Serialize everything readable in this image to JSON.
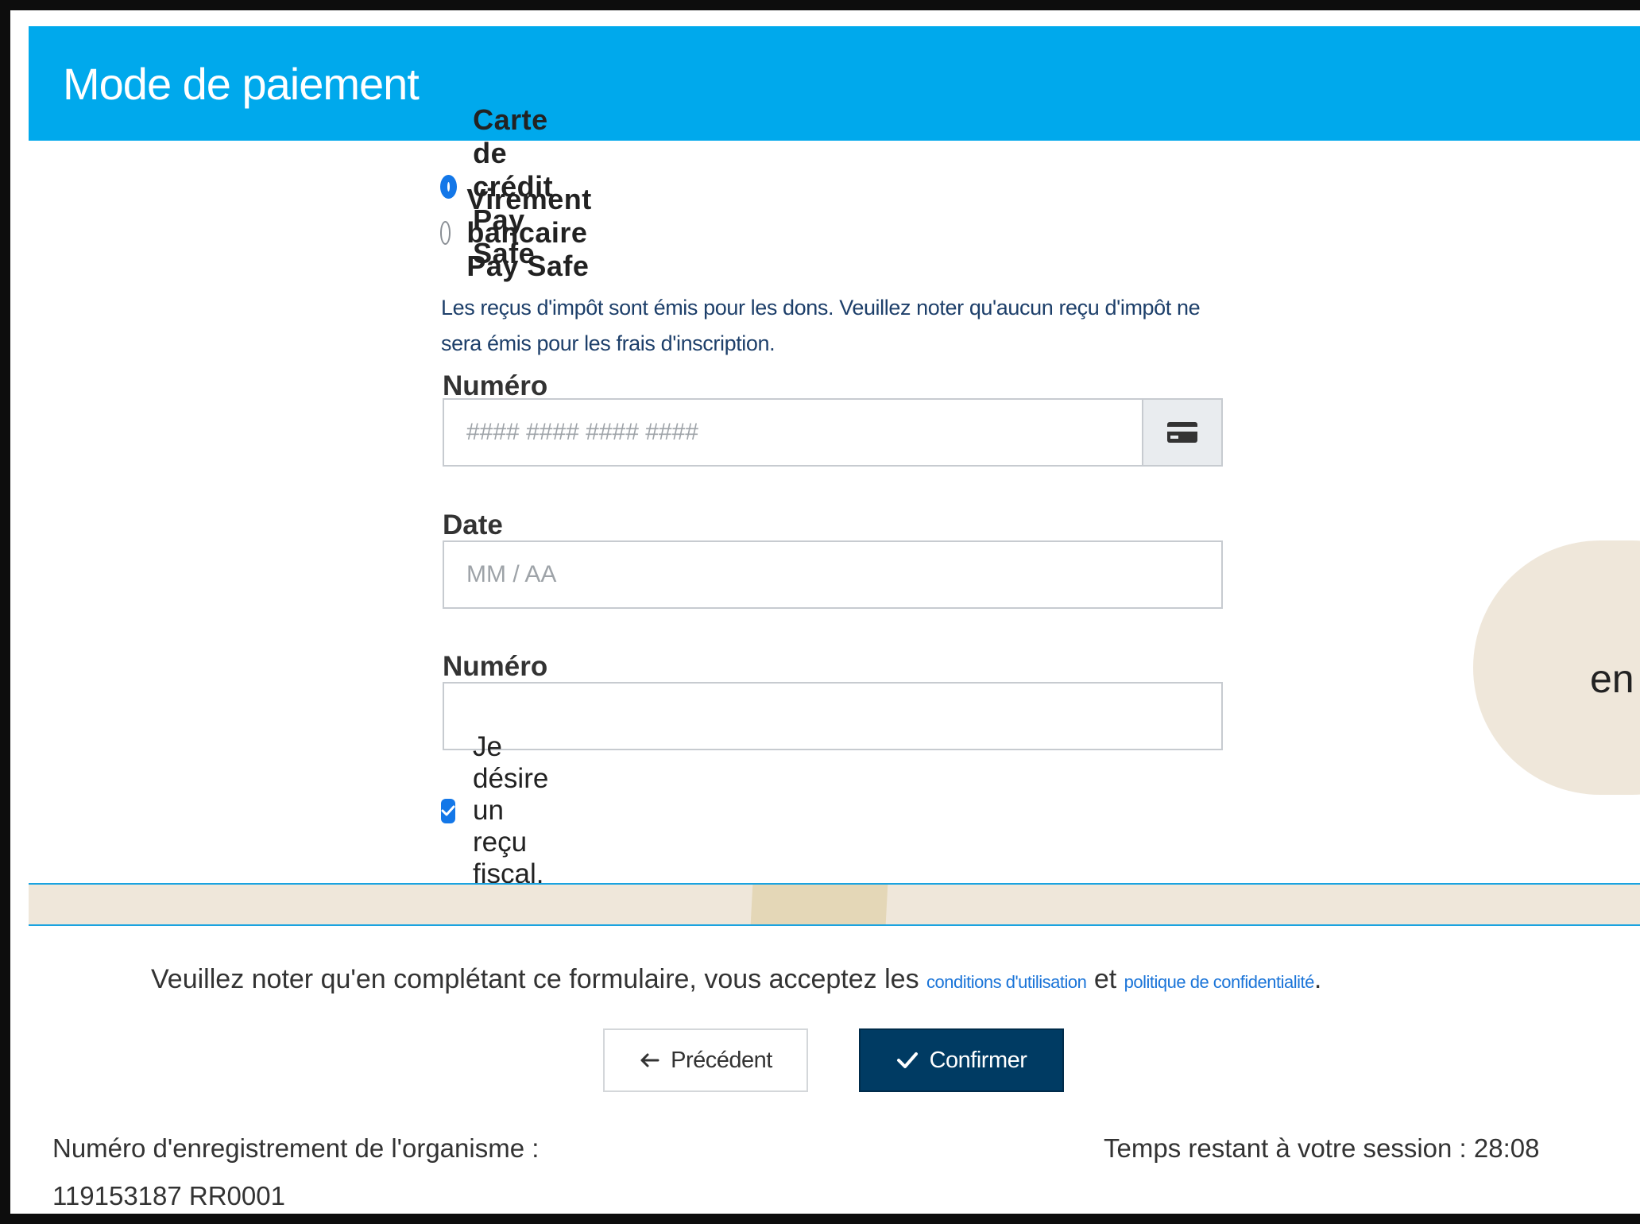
{
  "header": {
    "title": "Mode de paiement"
  },
  "payment_options": [
    {
      "label": "Carte de crédit Pay Safe",
      "selected": true
    },
    {
      "label": "Virement bancaire Pay Safe",
      "selected": false
    }
  ],
  "tax_note": "Les reçus d'impôt sont émis pour les dons. Veuillez noter qu'aucun reçu d'impôt ne sera émis pour les frais d'inscription.",
  "card_number": {
    "label": "Numéro de carte",
    "placeholder": "#### #### #### ####",
    "icon": "credit-card-icon"
  },
  "expiry": {
    "label": "Date d'expiration",
    "placeholder": "MM / AA"
  },
  "cvv": {
    "label": "Numéro de contrôle",
    "placeholder": ""
  },
  "tax_receipt": {
    "label": "Je désire un reçu fiscal.",
    "checked": true
  },
  "side_bubble": {
    "text": "en"
  },
  "terms": {
    "prefix": "Veuillez noter qu'en complétant ce formulaire, vous acceptez les",
    "terms_link": "conditions d'utilisation",
    "conjunction": "et",
    "privacy_link": "politique de confidentialité",
    "suffix": "."
  },
  "buttons": {
    "previous_label": "Précédent",
    "confirm_label": "Confirmer"
  },
  "footer": {
    "registration_label": "Numéro d'enregistrement de l'organisme :",
    "registration_number": "119153187 RR0001",
    "session_timer": "Temps restant à votre session : 28:08"
  },
  "colors": {
    "header_blue": "#00a9ec",
    "accent_blue": "#1377e8",
    "confirm_navy": "#003b63",
    "beige": "#efe7da"
  }
}
